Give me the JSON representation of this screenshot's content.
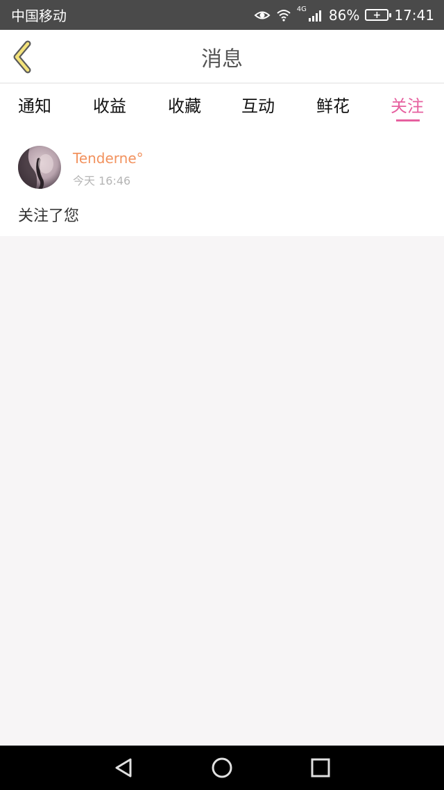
{
  "status_bar": {
    "carrier": "中国移动",
    "network": "4G",
    "battery_percent": "86%",
    "time": "17:41",
    "icons": [
      "eye-icon",
      "wifi-icon",
      "signal-icon",
      "battery-icon"
    ]
  },
  "header": {
    "title": "消息",
    "back_icon": "chevron-left-icon"
  },
  "tabs": [
    {
      "label": "通知",
      "active": false
    },
    {
      "label": "收益",
      "active": false
    },
    {
      "label": "收藏",
      "active": false
    },
    {
      "label": "互动",
      "active": false
    },
    {
      "label": "鲜花",
      "active": false
    },
    {
      "label": "关注",
      "active": true
    }
  ],
  "feed": {
    "items": [
      {
        "username": "Tenderne°",
        "time": "今天 16:46",
        "message": "关注了您"
      }
    ]
  },
  "colors": {
    "accent": "#e6609f",
    "username": "#f2925e",
    "status_bar": "#4a4a4a",
    "back_chevron": "#f3e27a"
  },
  "nav_bar": {
    "icons": [
      "back-triangle-icon",
      "home-circle-icon",
      "recents-square-icon"
    ]
  }
}
